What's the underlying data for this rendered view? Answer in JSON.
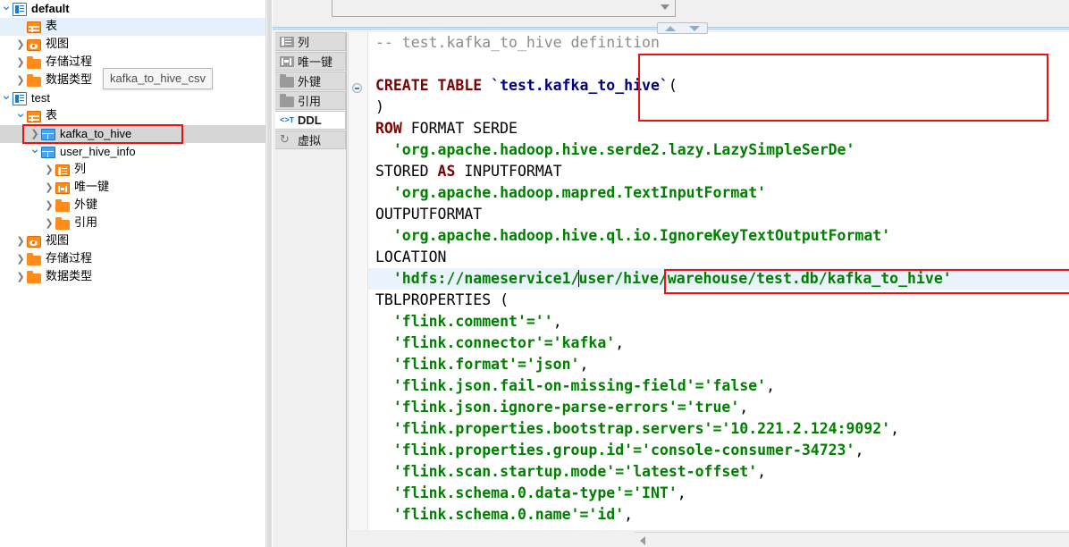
{
  "sidebar": {
    "nodes": [
      {
        "indent": 0,
        "twisty": "v",
        "icon": "database-icon",
        "label": "default",
        "bold": true,
        "selected": ""
      },
      {
        "indent": 1,
        "twisty": "",
        "icon": "table-folder-icon",
        "label": "表",
        "bold": false,
        "selected": "blue"
      },
      {
        "indent": 1,
        "twisty": ">",
        "icon": "view-eye-icon",
        "label": "视图",
        "bold": false,
        "selected": ""
      },
      {
        "indent": 1,
        "twisty": ">",
        "icon": "folder-icon",
        "label": "存储过程",
        "bold": false,
        "selected": ""
      },
      {
        "indent": 1,
        "twisty": ">",
        "icon": "folder-icon",
        "label": "数据类型",
        "bold": false,
        "selected": ""
      },
      {
        "indent": 0,
        "twisty": "v",
        "icon": "database-icon",
        "label": "test",
        "bold": false,
        "selected": ""
      },
      {
        "indent": 1,
        "twisty": "v",
        "icon": "table-folder-icon",
        "label": "表",
        "bold": false,
        "selected": ""
      },
      {
        "indent": 2,
        "twisty": ">",
        "icon": "table-icon",
        "label": "kafka_to_hive",
        "bold": false,
        "selected": "gray"
      },
      {
        "indent": 2,
        "twisty": "v",
        "icon": "table-icon",
        "label": "user_hive_info",
        "bold": false,
        "selected": ""
      },
      {
        "indent": 3,
        "twisty": ">",
        "icon": "columns-icon",
        "label": "列",
        "bold": false,
        "selected": ""
      },
      {
        "indent": 3,
        "twisty": ">",
        "icon": "unique-key-icon",
        "label": "唯一键",
        "bold": false,
        "selected": ""
      },
      {
        "indent": 3,
        "twisty": ">",
        "icon": "folder-icon",
        "label": "外键",
        "bold": false,
        "selected": ""
      },
      {
        "indent": 3,
        "twisty": ">",
        "icon": "folder-icon",
        "label": "引用",
        "bold": false,
        "selected": ""
      },
      {
        "indent": 1,
        "twisty": ">",
        "icon": "view-eye-icon",
        "label": "视图",
        "bold": false,
        "selected": ""
      },
      {
        "indent": 1,
        "twisty": ">",
        "icon": "folder-icon",
        "label": "存储过程",
        "bold": false,
        "selected": ""
      },
      {
        "indent": 1,
        "twisty": ">",
        "icon": "folder-icon",
        "label": "数据类型",
        "bold": false,
        "selected": ""
      }
    ],
    "tooltip": "kafka_to_hive_csv"
  },
  "combobox": {
    "value": "",
    "placeholder": ""
  },
  "tabs": [
    {
      "label": "列",
      "icon": "columns-icon",
      "active": false
    },
    {
      "label": "唯一键",
      "icon": "unique-key-icon",
      "active": false
    },
    {
      "label": "外键",
      "icon": "folder-icon",
      "active": false
    },
    {
      "label": "引用",
      "icon": "folder-icon",
      "active": false
    },
    {
      "label": "DDL",
      "icon": "ddl-icon",
      "active": true
    },
    {
      "label": "虚拟",
      "icon": "virtual-icon",
      "active": false
    }
  ],
  "editor": {
    "lines": [
      {
        "current": false,
        "tokens": [
          {
            "c": "cmt",
            "t": "-- test.kafka_to_hive definition"
          }
        ]
      },
      {
        "current": false,
        "tokens": [
          {
            "c": "pln",
            "t": ""
          }
        ]
      },
      {
        "current": false,
        "tokens": [
          {
            "c": "kw",
            "t": "CREATE TABLE "
          },
          {
            "c": "id",
            "t": "`test.kafka_to_hive`"
          },
          {
            "c": "pln",
            "t": "("
          }
        ]
      },
      {
        "current": false,
        "tokens": [
          {
            "c": "pln",
            "t": ")"
          }
        ]
      },
      {
        "current": false,
        "tokens": [
          {
            "c": "kw",
            "t": "ROW"
          },
          {
            "c": "pln",
            "t": " FORMAT SERDE"
          }
        ]
      },
      {
        "current": false,
        "tokens": [
          {
            "c": "str",
            "t": "  'org.apache.hadoop.hive.serde2.lazy.LazySimpleSerDe'"
          }
        ]
      },
      {
        "current": false,
        "tokens": [
          {
            "c": "pln",
            "t": "STORED "
          },
          {
            "c": "kw",
            "t": "AS"
          },
          {
            "c": "pln",
            "t": " INPUTFORMAT"
          }
        ]
      },
      {
        "current": false,
        "tokens": [
          {
            "c": "str",
            "t": "  'org.apache.hadoop.mapred.TextInputFormat'"
          }
        ]
      },
      {
        "current": false,
        "tokens": [
          {
            "c": "pln",
            "t": "OUTPUTFORMAT"
          }
        ]
      },
      {
        "current": false,
        "tokens": [
          {
            "c": "str",
            "t": "  'org.apache.hadoop.hive.ql.io.IgnoreKeyTextOutputFormat'"
          }
        ]
      },
      {
        "current": false,
        "tokens": [
          {
            "c": "pln",
            "t": "LOCATION"
          }
        ]
      },
      {
        "current": true,
        "tokens": [
          {
            "c": "str",
            "t": "  'hdfs://nameservice1/"
          },
          {
            "c": "caret",
            "t": ""
          },
          {
            "c": "str",
            "t": "user/hive/warehouse/test.db/kafka_to_hive'"
          }
        ]
      },
      {
        "current": false,
        "tokens": [
          {
            "c": "pln",
            "t": "TBLPROPERTIES ("
          }
        ]
      },
      {
        "current": false,
        "tokens": [
          {
            "c": "str",
            "t": "  'flink.comment'=''"
          },
          {
            "c": "pln",
            "t": ","
          }
        ]
      },
      {
        "current": false,
        "tokens": [
          {
            "c": "str",
            "t": "  'flink.connector'='kafka'"
          },
          {
            "c": "pln",
            "t": ","
          }
        ]
      },
      {
        "current": false,
        "tokens": [
          {
            "c": "str",
            "t": "  'flink.format'='json'"
          },
          {
            "c": "pln",
            "t": ","
          }
        ]
      },
      {
        "current": false,
        "tokens": [
          {
            "c": "str",
            "t": "  'flink.json.fail-on-missing-field'='false'"
          },
          {
            "c": "pln",
            "t": ","
          }
        ]
      },
      {
        "current": false,
        "tokens": [
          {
            "c": "str",
            "t": "  'flink.json.ignore-parse-errors'='true'"
          },
          {
            "c": "pln",
            "t": ","
          }
        ]
      },
      {
        "current": false,
        "tokens": [
          {
            "c": "str",
            "t": "  'flink.properties.bootstrap.servers'='10.221.2.124:9092'"
          },
          {
            "c": "pln",
            "t": ","
          }
        ]
      },
      {
        "current": false,
        "tokens": [
          {
            "c": "str",
            "t": "  'flink.properties.group.id'='console-consumer-34723'"
          },
          {
            "c": "pln",
            "t": ","
          }
        ]
      },
      {
        "current": false,
        "tokens": [
          {
            "c": "str",
            "t": "  'flink.scan.startup.mode'='latest-offset'"
          },
          {
            "c": "pln",
            "t": ","
          }
        ]
      },
      {
        "current": false,
        "tokens": [
          {
            "c": "str",
            "t": "  'flink.schema.0.data-type'='INT'"
          },
          {
            "c": "pln",
            "t": ","
          }
        ]
      },
      {
        "current": false,
        "tokens": [
          {
            "c": "str",
            "t": "  'flink.schema.0.name'='id'"
          },
          {
            "c": "pln",
            "t": ","
          }
        ]
      }
    ]
  },
  "colors": {
    "keyword": "#7f0000",
    "identifier": "#00007f",
    "string": "#008000",
    "comment": "#8c8c8c",
    "highlight_box": "#ee1111",
    "selection_blue": "#e4f0fb",
    "selection_gray": "#d6d6d6",
    "icon_orange": "#ff8c1a",
    "icon_blue": "#1f78c1"
  }
}
